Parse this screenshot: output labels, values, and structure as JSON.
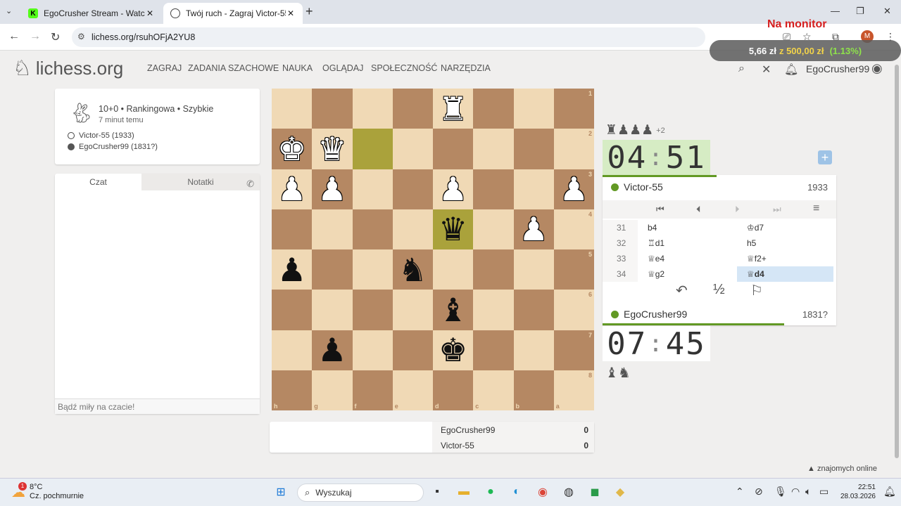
{
  "browser": {
    "tabs": [
      {
        "title": "EgoCrusher Stream - Watch Liv",
        "favicon": "kick-favicon",
        "active": false
      },
      {
        "title": "Twój ruch - Zagraj Victor-55 • li",
        "favicon": "lichess-favicon",
        "active": true
      }
    ],
    "url": "lichess.org/rsuhOFjA2YU8",
    "profile_initial": "M"
  },
  "overlay": {
    "title": "Na monitor",
    "amount": "5,66 zł",
    "of": "z",
    "base": "500,00 zł",
    "pct": "(1.13%)"
  },
  "lichess": {
    "logo": "lichess.org",
    "nav": [
      "ZAGRAJ",
      "ZADANIA SZACHOWE",
      "NAUKA",
      "OGLĄDAJ",
      "SPOŁECZNOŚĆ",
      "NARZĘDZIA"
    ],
    "username": "EgoCrusher99"
  },
  "game_info": {
    "setup": "10+0 • Rankingowa • Szybkie",
    "ago": "7 minut temu",
    "white": "Victor-55 (1933)",
    "black": "EgoCrusher99 (1831?)"
  },
  "chat": {
    "tab_chat": "Czat",
    "tab_notes": "Notatki",
    "placeholder": "Bądź miły na czacie!"
  },
  "board": {
    "ranks": [
      "1",
      "2",
      "3",
      "4",
      "5",
      "6",
      "7",
      "8"
    ],
    "files": [
      "h",
      "g",
      "f",
      "e",
      "d",
      "c",
      "b",
      "a"
    ],
    "pieces": {
      "0-4": {
        "glyph": "♜",
        "color": "w"
      },
      "1-0": {
        "glyph": "♚",
        "color": "w"
      },
      "1-1": {
        "glyph": "♛",
        "color": "w"
      },
      "2-0": {
        "glyph": "♟",
        "color": "w"
      },
      "2-1": {
        "glyph": "♟",
        "color": "w"
      },
      "2-4": {
        "glyph": "♟",
        "color": "w"
      },
      "2-7": {
        "glyph": "♟",
        "color": "w"
      },
      "3-4": {
        "glyph": "♛",
        "color": "b"
      },
      "3-6": {
        "glyph": "♟",
        "color": "w"
      },
      "4-0": {
        "glyph": "♟",
        "color": "b"
      },
      "4-3": {
        "glyph": "♞",
        "color": "b"
      },
      "5-4": {
        "glyph": "♝",
        "color": "b"
      },
      "6-1": {
        "glyph": "♟",
        "color": "b"
      },
      "6-4": {
        "glyph": "♚",
        "color": "b"
      }
    },
    "highlights": [
      "1-2",
      "3-4"
    ]
  },
  "score": {
    "p1_name": "EgoCrusher99",
    "p1_score": "0",
    "p2_name": "Victor-55",
    "p2_score": "0"
  },
  "opponent": {
    "captured": "♜♟♟♟",
    "captured_plus": "+2",
    "clock_min": "04",
    "clock_sec": "51",
    "name": "Victor-55",
    "rating": "1933"
  },
  "moves": [
    {
      "num": "31",
      "white": "b4",
      "black": "♔d7"
    },
    {
      "num": "32",
      "white": "♖d1",
      "black": "h5"
    },
    {
      "num": "33",
      "white": "♕e4",
      "black": "♕f2+"
    },
    {
      "num": "34",
      "white": "♕g2",
      "black": "♕d4"
    }
  ],
  "actions": {
    "takeback": "↶",
    "draw": "½",
    "resign": "⚐"
  },
  "me": {
    "name": "EgoCrusher99",
    "rating": "1831?",
    "clock_min": "07",
    "clock_sec": "45",
    "captured": "♝♞"
  },
  "friends": "znajomych online",
  "taskbar": {
    "temp": "8°C",
    "weather": "Cz. pochmurnie",
    "weather_badge": "1",
    "search": "Wyszukaj",
    "time": "22:51",
    "date": "28.03.2026"
  }
}
